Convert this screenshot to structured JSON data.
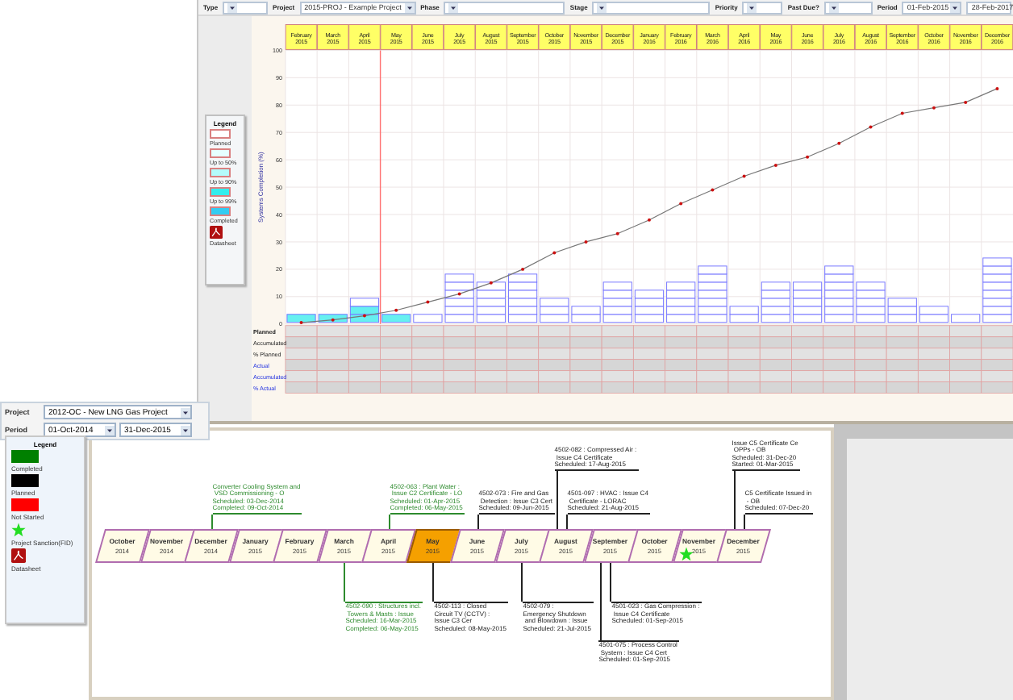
{
  "chart_window": {
    "filters": [
      {
        "label": "Type"
      },
      {
        "label": "Project",
        "values": [
          "2015-PROJ - Example Project"
        ]
      },
      {
        "label": "Phase"
      },
      {
        "label": "Stage"
      },
      {
        "label": "Priority"
      },
      {
        "label": "Past Due?"
      },
      {
        "label": "Period",
        "values": [
          "01-Feb-2015",
          "28-Feb-2017"
        ]
      }
    ],
    "legend": {
      "title": "Legend",
      "items": [
        {
          "kind": "swatch",
          "label": "Planned",
          "color": "#ffffff"
        },
        {
          "kind": "swatch",
          "label": "Up to 50%",
          "color": "#e6ffff"
        },
        {
          "kind": "swatch",
          "label": "Up to 90%",
          "color": "#b4fbfb"
        },
        {
          "kind": "swatch",
          "label": "Up to 99%",
          "color": "#33eeee"
        },
        {
          "kind": "swatch",
          "label": "Completed",
          "color": "#33ccf2"
        },
        {
          "kind": "pdf",
          "label": "Datasheet"
        }
      ]
    },
    "chart_data": {
      "type": "line",
      "ylabel": "Systems Completion (%)",
      "grid": true,
      "categories": [
        "February 2015",
        "March 2015",
        "April 2015",
        "May 2015",
        "June 2015",
        "July 2015",
        "August 2015",
        "September 2015",
        "October 2015",
        "November 2015",
        "December 2015",
        "January 2016",
        "February 2016",
        "March 2016",
        "April 2016",
        "May 2016",
        "June 2016",
        "July 2016",
        "August 2016",
        "September 2016",
        "October 2016",
        "November 2016",
        "December 2016"
      ],
      "series": [
        {
          "color": "#777777",
          "values": [
            0.5,
            1.5,
            3,
            5,
            8,
            11,
            15,
            20,
            26,
            30,
            33,
            38,
            44,
            49,
            54,
            58,
            61,
            66,
            72,
            77,
            79,
            81,
            86
          ]
        }
      ],
      "ref_lines": [
        {
          "axis": "x",
          "value": "May 2015",
          "color": "#ff7070"
        }
      ],
      "ylim": [
        0,
        100
      ],
      "yticks": [
        0,
        10,
        20,
        30,
        40,
        50,
        60,
        70,
        80,
        90,
        100
      ]
    },
    "table_rows": [
      {
        "label": "Planned",
        "kind": "planned"
      },
      {
        "label": "Accumulated",
        "kind": "planned"
      },
      {
        "label": "% Planned",
        "kind": "planned"
      },
      {
        "label": "Actual",
        "kind": "actual"
      },
      {
        "label": "Accumulated",
        "kind": "actual"
      },
      {
        "label": "% Actual",
        "kind": "actual"
      }
    ]
  },
  "project_panel": {
    "fields": [
      {
        "label": "Project",
        "values": [
          "2012-OC - New LNG Gas Project"
        ]
      },
      {
        "label": "Period",
        "values": [
          "01-Oct-2014",
          "31-Dec-2015"
        ]
      }
    ]
  },
  "timeline_window": {
    "legend": {
      "title": "Legend",
      "items": [
        {
          "kind": "swatch",
          "label": "Completed",
          "color": "#008000"
        },
        {
          "kind": "swatch",
          "label": "Planned",
          "color": "#000000"
        },
        {
          "kind": "swatch",
          "label": "Not Started",
          "color": "#ff0000"
        },
        {
          "kind": "star",
          "label": "Project Sanction(FID)"
        },
        {
          "kind": "pdf",
          "label": "Datasheet"
        }
      ]
    },
    "months": [
      {
        "month": "October",
        "year": "2014",
        "selected": false,
        "milestone": false
      },
      {
        "month": "November",
        "year": "2014",
        "selected": false,
        "milestone": false
      },
      {
        "month": "December",
        "year": "2014",
        "selected": false,
        "milestone": false,
        "above": [
          {
            "kind": "completed",
            "text": "Converter Cooling System and\n VSD Commissioning - O\nScheduled: 03-Dec-2014\nCompleted: 09-Oct-2014"
          }
        ]
      },
      {
        "month": "January",
        "year": "2015",
        "selected": false,
        "milestone": false
      },
      {
        "month": "February",
        "year": "2015",
        "selected": false,
        "milestone": false
      },
      {
        "month": "March",
        "year": "2015",
        "selected": false,
        "milestone": false,
        "below": [
          {
            "kind": "completed",
            "text": "4502-090 : Structures incl.\n Towers & Masts : Issue\nScheduled: 16-Mar-2015\nCompleted: 06-May-2015"
          }
        ]
      },
      {
        "month": "April",
        "year": "2015",
        "selected": false,
        "milestone": false,
        "above": [
          {
            "kind": "completed",
            "text": "4502-063 : Plant Water :\n Issue C2 Certificate - LO\nScheduled: 01-Apr-2015\nCompleted: 06-May-2015"
          }
        ]
      },
      {
        "month": "May",
        "year": "2015",
        "selected": true,
        "milestone": false,
        "below": [
          {
            "kind": "planned",
            "text": "4502-113 : Closed\nCircuit TV (CCTV) :\nIssue C3 Cer\nScheduled: 08-May-2015"
          }
        ]
      },
      {
        "month": "June",
        "year": "2015",
        "selected": false,
        "milestone": false,
        "above": [
          {
            "kind": "planned",
            "text": "4502-073 : Fire and Gas\n Detection : Issue C3 Cert\nScheduled: 09-Jun-2015"
          }
        ]
      },
      {
        "month": "July",
        "year": "2015",
        "selected": false,
        "milestone": false,
        "below": [
          {
            "kind": "planned",
            "text": "4502-079 :\nEmergency Shutdown\n and Blowdown : Issue\nScheduled: 21-Jul-2015"
          }
        ]
      },
      {
        "month": "August",
        "year": "2015",
        "selected": false,
        "milestone": false,
        "above": [
          {
            "kind": "planned",
            "text": "4502-082 : Compressed Air :\n Issue C4 Certificate\nScheduled: 17-Aug-2015"
          },
          {
            "kind": "planned",
            "text": "4501-097 : HVAC : Issue C4\n Certificate - LORAC\nScheduled: 21-Aug-2015"
          }
        ]
      },
      {
        "month": "September",
        "year": "2015",
        "selected": false,
        "milestone": false,
        "below": [
          {
            "kind": "planned",
            "text": "4501-023 : Gas Compression :\n Issue C4 Certificate\nScheduled: 01-Sep-2015"
          },
          {
            "kind": "planned",
            "text": "4501-075 : Process Control\n System : Issue C4 Cert\nScheduled: 01-Sep-2015"
          }
        ]
      },
      {
        "month": "October",
        "year": "2015",
        "selected": false,
        "milestone": false
      },
      {
        "month": "November",
        "year": "2015",
        "selected": false,
        "milestone": true
      },
      {
        "month": "December",
        "year": "2015",
        "selected": false,
        "milestone": false,
        "above": [
          {
            "kind": "planned",
            "text": "Issue C5 Certificate Ce\n OPPs - OB\nScheduled: 31-Dec-20\nStarted: 01-Mar-2015"
          },
          {
            "kind": "planned",
            "text": "C5 Certificate Issued in\n - OB\nScheduled: 07-Dec-20"
          }
        ]
      }
    ]
  }
}
